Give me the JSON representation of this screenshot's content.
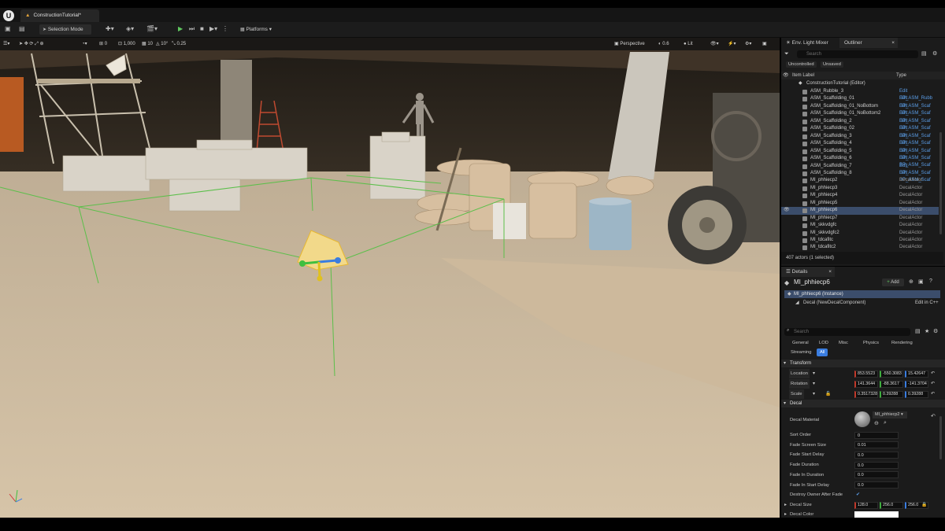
{
  "window": {
    "logo": "U",
    "tab_title": "ConstructionTutorial*"
  },
  "toolbar": {
    "selection_mode": "Selection Mode",
    "platforms": "Platforms"
  },
  "viewport_toolbar": {
    "grid_value": "10",
    "angle_value": "10°",
    "scale_value": "0.25",
    "camera_speed": "1,000",
    "view_mode": "Perspective",
    "fov_value": "0.6",
    "lit": "Lit",
    "zero": "0"
  },
  "panel_tabs": {
    "env_light_mixer": "Env. Light Mixer",
    "outliner": "Outliner"
  },
  "outliner": {
    "search_placeholder": "Search",
    "filter_uncontrolled": "Uncontrolled",
    "filter_unsaved": "Unsaved",
    "col_item_label": "Item Label",
    "col_type": "Type",
    "root": "ConstructionTutorial (Editor)",
    "rows": [
      {
        "label": "ASM_Rubble_3",
        "type": "Edit BP_ASM_Rubb"
      },
      {
        "label": "ASM_Scaffolding_01",
        "type": "Edit BP_ASM_Scaf"
      },
      {
        "label": "ASM_Scaffolding_01_NoBottom",
        "type": "Edit BP_ASM_Scaf"
      },
      {
        "label": "ASM_Scaffolding_01_NoBottom2",
        "type": "Edit BP_ASM_Scaf"
      },
      {
        "label": "ASM_Scaffolding_2",
        "type": "Edit BP_ASM_Scaf"
      },
      {
        "label": "ASM_Scaffolding_02",
        "type": "Edit BP_ASM_Scaf"
      },
      {
        "label": "ASM_Scaffolding_3",
        "type": "Edit BP_ASM_Scaf"
      },
      {
        "label": "ASM_Scaffolding_4",
        "type": "Edit BP_ASM_Scaf"
      },
      {
        "label": "ASM_Scaffolding_5",
        "type": "Edit BP_ASM_Scaf"
      },
      {
        "label": "ASM_Scaffolding_6",
        "type": "Edit BP_ASM_Scaf"
      },
      {
        "label": "ASM_Scaffolding_7",
        "type": "Edit BP_ASM_Scaf"
      },
      {
        "label": "ASM_Scaffolding_8",
        "type": "Edit BP_ASM_Scaf"
      },
      {
        "label": "MI_phhiecp2",
        "type": "DecalActor"
      },
      {
        "label": "MI_phhiecp3",
        "type": "DecalActor"
      },
      {
        "label": "MI_phhiecp4",
        "type": "DecalActor"
      },
      {
        "label": "MI_phhiecp5",
        "type": "DecalActor"
      },
      {
        "label": "MI_phhiecp6",
        "type": "DecalActor"
      },
      {
        "label": "MI_phhiecp7",
        "type": "DecalActor"
      },
      {
        "label": "MI_skkvdgfc",
        "type": "DecalActor"
      },
      {
        "label": "MI_skkvdgfc2",
        "type": "DecalActor"
      },
      {
        "label": "MI_tdcafitc",
        "type": "DecalActor"
      },
      {
        "label": "MI_tdcafitc2",
        "type": "DecalActor"
      }
    ],
    "status": "407 actors (1 selected)"
  },
  "details": {
    "tab": "Details",
    "actor_name": "MI_phhiecp6",
    "add_label": "Add",
    "instance_label": "MI_phhiecp6 (Instance)",
    "component_label": "Decal (NewDecalComponent)",
    "edit_cpp": "Edit in C++",
    "search_placeholder": "Search",
    "filters": [
      "General",
      "LOD",
      "Misc",
      "Physics",
      "Rendering",
      "Streaming",
      "All"
    ],
    "transform_header": "Transform",
    "location_label": "Location",
    "location": [
      "853.5523",
      "-550.3083",
      "15.42647"
    ],
    "rotation_label": "Rotation",
    "rotation": [
      "141.3644",
      "-88.3617",
      "-141.3704"
    ],
    "scale_label": "Scale",
    "scale": [
      "0.3517328",
      "0.39288",
      "0.39288"
    ],
    "decal_header": "Decal",
    "decal_material_label": "Decal Material",
    "decal_material_value": "MI_phhiecp2",
    "props": [
      {
        "label": "Sort Order",
        "value": "0"
      },
      {
        "label": "Fade Screen Size",
        "value": "0.01"
      },
      {
        "label": "Fade Start Delay",
        "value": "0.0"
      },
      {
        "label": "Fade Duration",
        "value": "0.0"
      },
      {
        "label": "Fade In Duration",
        "value": "0.0"
      },
      {
        "label": "Fade In Start Delay",
        "value": "0.0"
      }
    ],
    "destroy_owner_label": "Destroy Owner After Fade",
    "decal_size_label": "Decal Size",
    "decal_size": [
      "128.0",
      "256.0",
      "256.0"
    ],
    "decal_color_label": "Decal Color"
  }
}
